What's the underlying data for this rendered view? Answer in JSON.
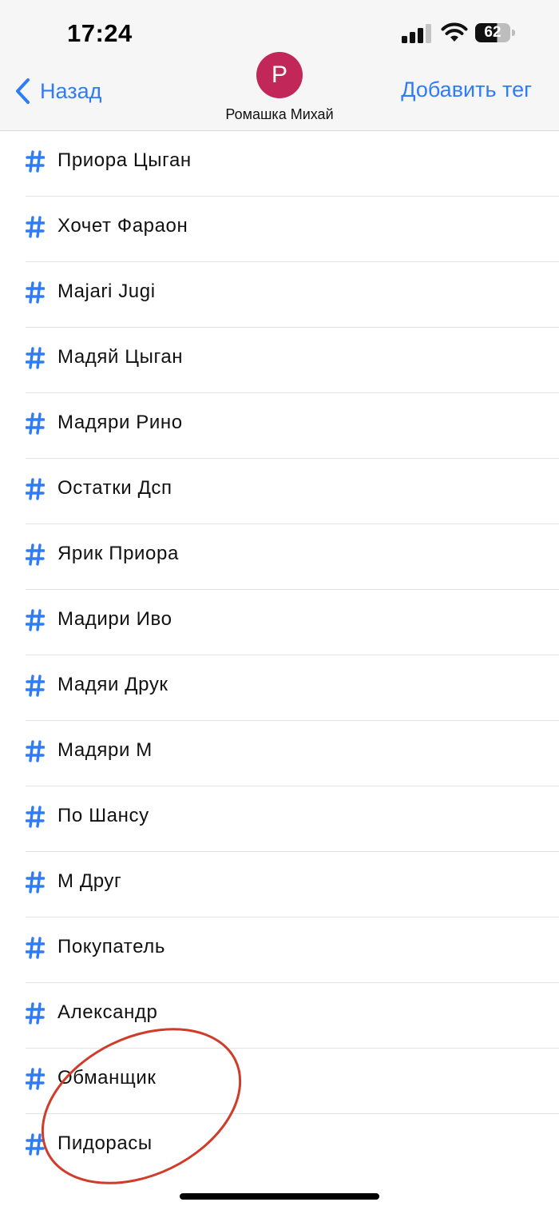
{
  "status_bar": {
    "time": "17:24",
    "battery_level": "62",
    "battery_fraction": 0.62
  },
  "header": {
    "back_label": "Назад",
    "avatar_initial": "P",
    "contact_name": "Ромашка Михай",
    "add_tag_label": "Добавить тег"
  },
  "colors": {
    "accent": "#2f7cf6",
    "avatar": "#c2275a",
    "annotation": "#d03c2a"
  },
  "tags": [
    {
      "label": "Приора Цыган"
    },
    {
      "label": "Хочет Фараон"
    },
    {
      "label": "Majari Jugi"
    },
    {
      "label": "Мадяй Цыган"
    },
    {
      "label": "Мадяри Рино"
    },
    {
      "label": "Остатки Дсп"
    },
    {
      "label": "Ярик Приора"
    },
    {
      "label": "Мадири Иво"
    },
    {
      "label": "Мадяи Друк"
    },
    {
      "label": "Мадяри М"
    },
    {
      "label": "По Шансу"
    },
    {
      "label": "М Друг"
    },
    {
      "label": "Покупатель"
    },
    {
      "label": "Александр"
    },
    {
      "label": "Обманщик"
    },
    {
      "label": "Пидорасы"
    }
  ]
}
